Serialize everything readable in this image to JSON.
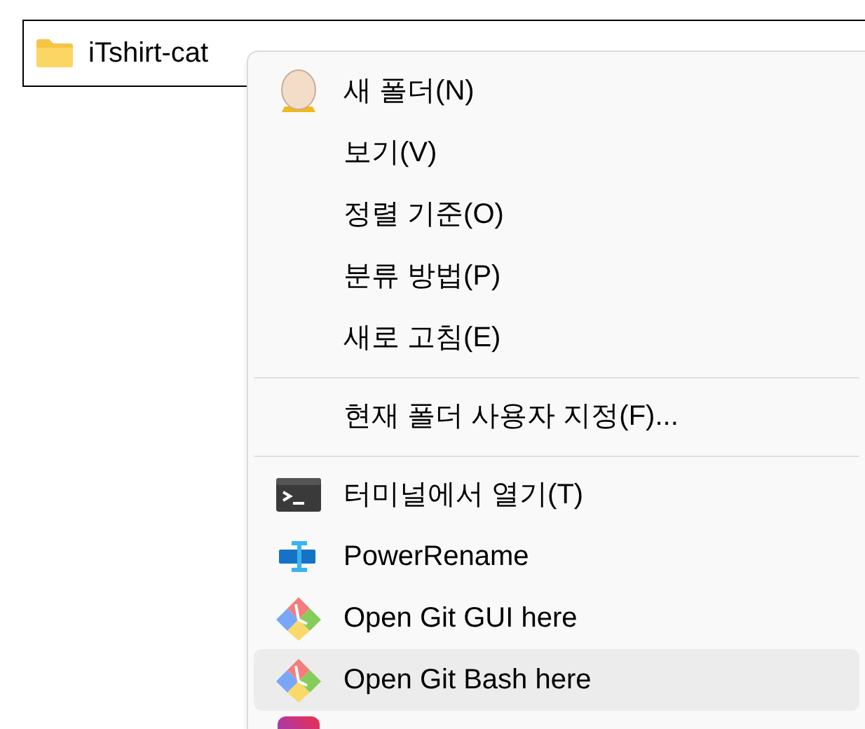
{
  "file_item": {
    "name": "iTshirt-cat"
  },
  "context_menu": {
    "items": [
      {
        "kind": "egg",
        "label": "새 폴더(N)",
        "selected": false
      },
      {
        "kind": "plain",
        "label": "보기(V)",
        "selected": false
      },
      {
        "kind": "plain",
        "label": "정렬 기준(O)",
        "selected": false
      },
      {
        "kind": "plain",
        "label": "분류 방법(P)",
        "selected": false
      },
      {
        "kind": "plain",
        "label": "새로 고침(E)",
        "selected": false
      },
      {
        "kind": "separator"
      },
      {
        "kind": "plain",
        "label": "현재 폴더 사용자 지정(F)...",
        "selected": false
      },
      {
        "kind": "separator"
      },
      {
        "kind": "terminal",
        "label": "터미널에서 열기(T)",
        "selected": false
      },
      {
        "kind": "rename",
        "label": "PowerRename",
        "selected": false
      },
      {
        "kind": "git",
        "label": "Open Git GUI here",
        "selected": false
      },
      {
        "kind": "git",
        "label": "Open Git Bash here",
        "selected": true
      },
      {
        "kind": "cut_off"
      }
    ]
  }
}
